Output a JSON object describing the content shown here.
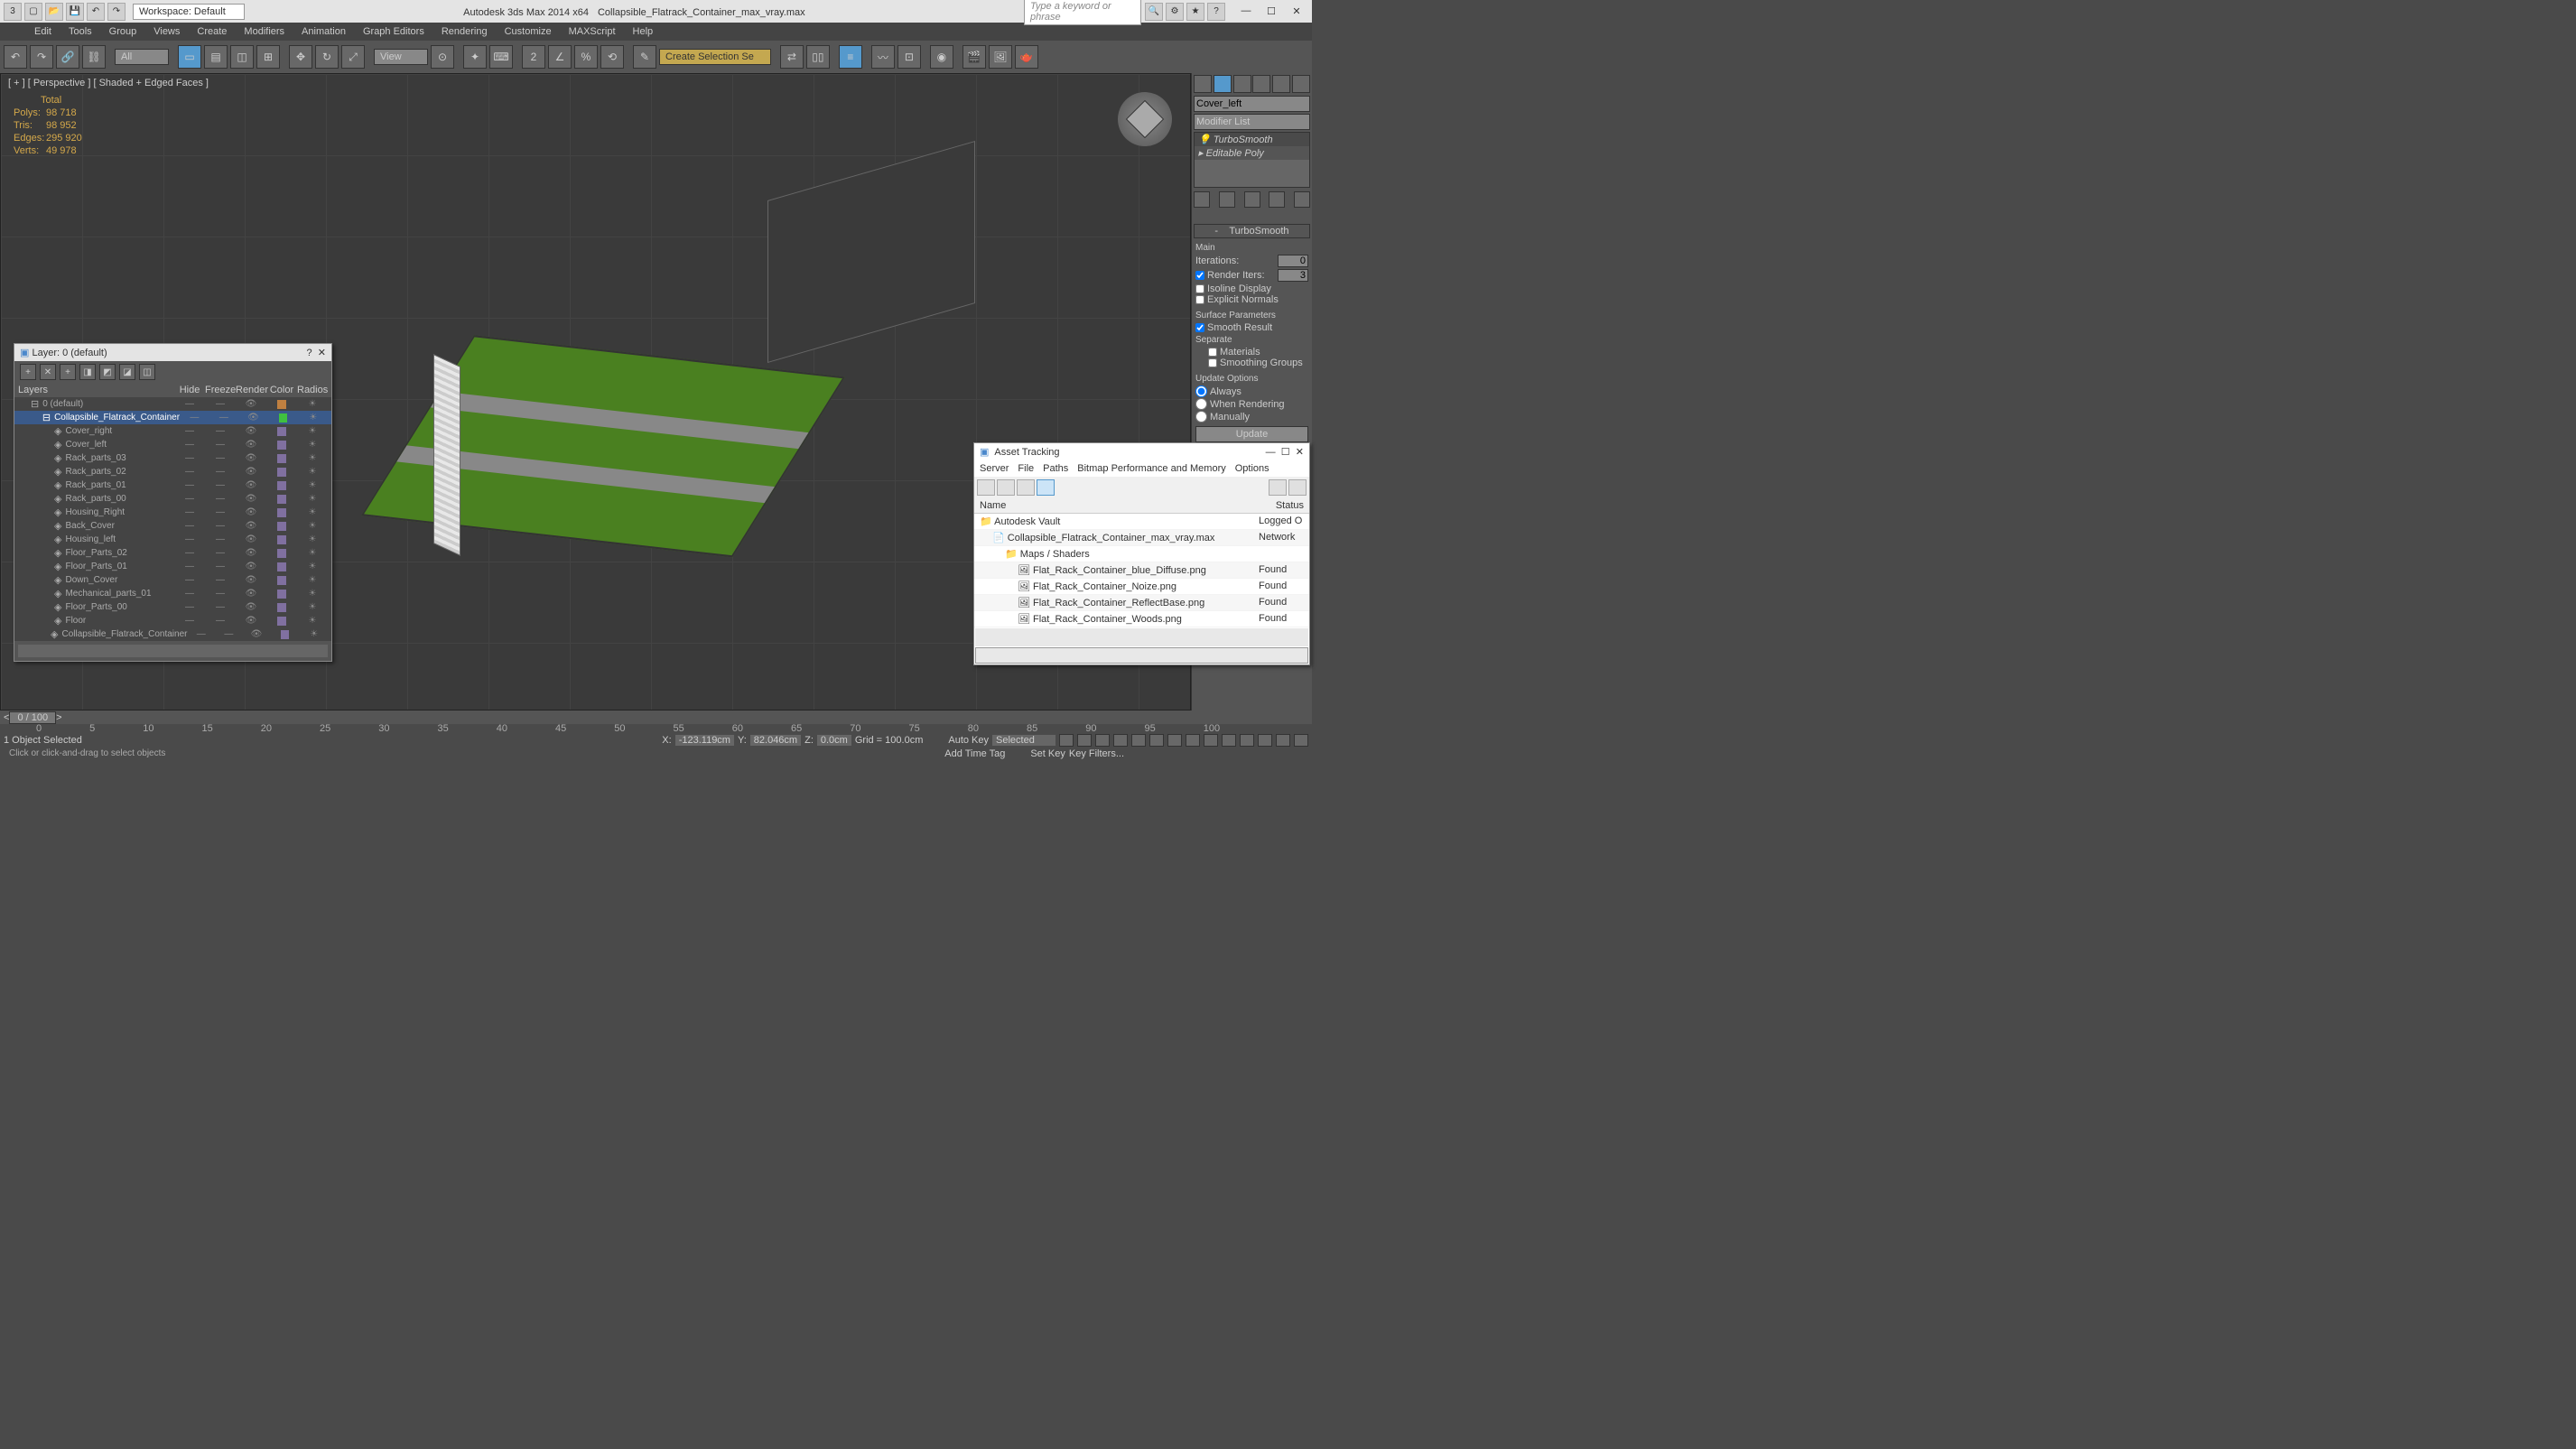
{
  "titlebar": {
    "workspace": "Workspace: Default",
    "title_app": "Autodesk 3ds Max  2014 x64",
    "title_file": "Collapsible_Flatrack_Container_max_vray.max",
    "search_placeholder": "Type a keyword or phrase"
  },
  "menu": [
    "Edit",
    "Tools",
    "Group",
    "Views",
    "Create",
    "Modifiers",
    "Animation",
    "Graph Editors",
    "Rendering",
    "Customize",
    "MAXScript",
    "Help"
  ],
  "toolbar": {
    "selset_dropdown": "All",
    "view_dropdown": "View",
    "create_sel": "Create Selection Se"
  },
  "viewport": {
    "label": "[ + ] [ Perspective ] [ Shaded + Edged Faces ]",
    "stats_title": "Total",
    "stats": [
      {
        "k": "Polys:",
        "v": "98 718"
      },
      {
        "k": "Tris:",
        "v": "98 952"
      },
      {
        "k": "Edges:",
        "v": "295 920"
      },
      {
        "k": "Verts:",
        "v": "49 978"
      }
    ]
  },
  "cmdpanel": {
    "obj_name": "Cover_left",
    "modifier_list": "Modifier List",
    "stack": [
      "TurboSmooth",
      "Editable Poly"
    ],
    "rollout_title": "TurboSmooth",
    "main_label": "Main",
    "iterations_lbl": "Iterations:",
    "iterations_val": "0",
    "render_iters_lbl": "Render Iters:",
    "render_iters_val": "3",
    "isoline": "Isoline Display",
    "explicit": "Explicit Normals",
    "surface_params": "Surface Parameters",
    "smooth_result": "Smooth Result",
    "separate": "Separate",
    "materials": "Materials",
    "smoothing_groups": "Smoothing Groups",
    "update_options": "Update Options",
    "always": "Always",
    "when_rendering": "When Rendering",
    "manually": "Manually",
    "update_btn": "Update"
  },
  "layer_dlg": {
    "title": "Layer: 0 (default)",
    "columns": [
      "Layers",
      "Hide",
      "Freeze",
      "Render",
      "Color",
      "Radios"
    ],
    "rows": [
      {
        "indent": 0,
        "name": "0 (default)",
        "sel": false,
        "color": "#c08040"
      },
      {
        "indent": 1,
        "name": "Collapsible_Flatrack_Container",
        "sel": true,
        "color": "#40c040"
      },
      {
        "indent": 2,
        "name": "Cover_right",
        "sel": false,
        "color": "#8070a0"
      },
      {
        "indent": 2,
        "name": "Cover_left",
        "sel": false,
        "color": "#8070a0"
      },
      {
        "indent": 2,
        "name": "Rack_parts_03",
        "sel": false,
        "color": "#8070a0"
      },
      {
        "indent": 2,
        "name": "Rack_parts_02",
        "sel": false,
        "color": "#8070a0"
      },
      {
        "indent": 2,
        "name": "Rack_parts_01",
        "sel": false,
        "color": "#8070a0"
      },
      {
        "indent": 2,
        "name": "Rack_parts_00",
        "sel": false,
        "color": "#8070a0"
      },
      {
        "indent": 2,
        "name": "Housing_Right",
        "sel": false,
        "color": "#8070a0"
      },
      {
        "indent": 2,
        "name": "Back_Cover",
        "sel": false,
        "color": "#8070a0"
      },
      {
        "indent": 2,
        "name": "Housing_left",
        "sel": false,
        "color": "#8070a0"
      },
      {
        "indent": 2,
        "name": "Floor_Parts_02",
        "sel": false,
        "color": "#8070a0"
      },
      {
        "indent": 2,
        "name": "Floor_Parts_01",
        "sel": false,
        "color": "#8070a0"
      },
      {
        "indent": 2,
        "name": "Down_Cover",
        "sel": false,
        "color": "#8070a0"
      },
      {
        "indent": 2,
        "name": "Mechanical_parts_01",
        "sel": false,
        "color": "#8070a0"
      },
      {
        "indent": 2,
        "name": "Floor_Parts_00",
        "sel": false,
        "color": "#8070a0"
      },
      {
        "indent": 2,
        "name": "Floor",
        "sel": false,
        "color": "#8070a0"
      },
      {
        "indent": 2,
        "name": "Collapsible_Flatrack_Container",
        "sel": false,
        "color": "#8070a0"
      }
    ]
  },
  "asset_dlg": {
    "title": "Asset Tracking",
    "menu": [
      "Server",
      "File",
      "Paths",
      "Bitmap Performance and Memory",
      "Options"
    ],
    "columns": [
      "Name",
      "Status"
    ],
    "rows": [
      {
        "indent": 0,
        "name": "Autodesk Vault",
        "status": "Logged O"
      },
      {
        "indent": 1,
        "name": "Collapsible_Flatrack_Container_max_vray.max",
        "status": "Network"
      },
      {
        "indent": 2,
        "name": "Maps / Shaders",
        "status": ""
      },
      {
        "indent": 3,
        "name": "Flat_Rack_Container_blue_Diffuse.png",
        "status": "Found"
      },
      {
        "indent": 3,
        "name": "Flat_Rack_Container_Noize.png",
        "status": "Found"
      },
      {
        "indent": 3,
        "name": "Flat_Rack_Container_ReflectBase.png",
        "status": "Found"
      },
      {
        "indent": 3,
        "name": "Flat_Rack_Container_Woods.png",
        "status": "Found"
      }
    ]
  },
  "timeline": {
    "current": "0 / 100",
    "ticks": [
      "0",
      "5",
      "10",
      "15",
      "20",
      "25",
      "30",
      "35",
      "40",
      "45",
      "50",
      "55",
      "60",
      "65",
      "70",
      "75",
      "80",
      "85",
      "90",
      "95",
      "100"
    ]
  },
  "status": {
    "selected": "1 Object Selected",
    "x_lbl": "X:",
    "x": "-123.119cm",
    "y_lbl": "Y:",
    "y": "82.046cm",
    "z_lbl": "Z:",
    "z": "0.0cm",
    "grid": "Grid = 100.0cm",
    "autokey": "Auto Key",
    "selected_filter": "Selected",
    "addtime": "Add Time Tag",
    "setkey": "Set Key",
    "keyfilters": "Key Filters..."
  },
  "prompt": "Click or click-and-drag to select objects"
}
